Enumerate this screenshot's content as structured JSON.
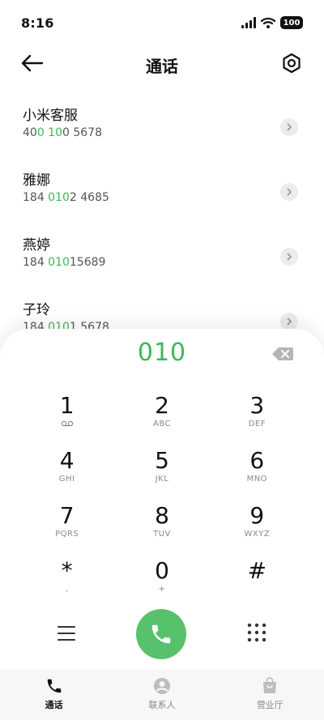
{
  "status": {
    "time": "8:16",
    "battery": "100"
  },
  "header": {
    "title": "通话"
  },
  "contacts": [
    {
      "name": "小米客服",
      "pre": "40",
      "match": "0 10",
      "post": "0 5678"
    },
    {
      "name": "雅娜",
      "pre": "184 ",
      "match": "010",
      "post": "2 4685"
    },
    {
      "name": "燕婷",
      "pre": "184 ",
      "match": "010",
      "post": "15689"
    },
    {
      "name": "子玲",
      "pre": "184 ",
      "match": "010",
      "post": "1 5678"
    }
  ],
  "dialer": {
    "input": "010",
    "keys": [
      {
        "digit": "1",
        "letters": ""
      },
      {
        "digit": "2",
        "letters": "ABC"
      },
      {
        "digit": "3",
        "letters": "DEF"
      },
      {
        "digit": "4",
        "letters": "GHI"
      },
      {
        "digit": "5",
        "letters": "JKL"
      },
      {
        "digit": "6",
        "letters": "MNO"
      },
      {
        "digit": "7",
        "letters": "PQRS"
      },
      {
        "digit": "8",
        "letters": "TUV"
      },
      {
        "digit": "9",
        "letters": "WXYZ"
      },
      {
        "digit": "*",
        "letters": ","
      },
      {
        "digit": "0",
        "letters": "+"
      },
      {
        "digit": "#",
        "letters": ""
      }
    ]
  },
  "tabs": [
    {
      "label": "通话",
      "icon": "phone-icon",
      "active": true
    },
    {
      "label": "联系人",
      "icon": "contacts-icon",
      "active": false
    },
    {
      "label": "营业厅",
      "icon": "shopping-bag-icon",
      "active": false
    }
  ],
  "colors": {
    "accent": "#3db85a",
    "call_button": "#57c26b"
  }
}
